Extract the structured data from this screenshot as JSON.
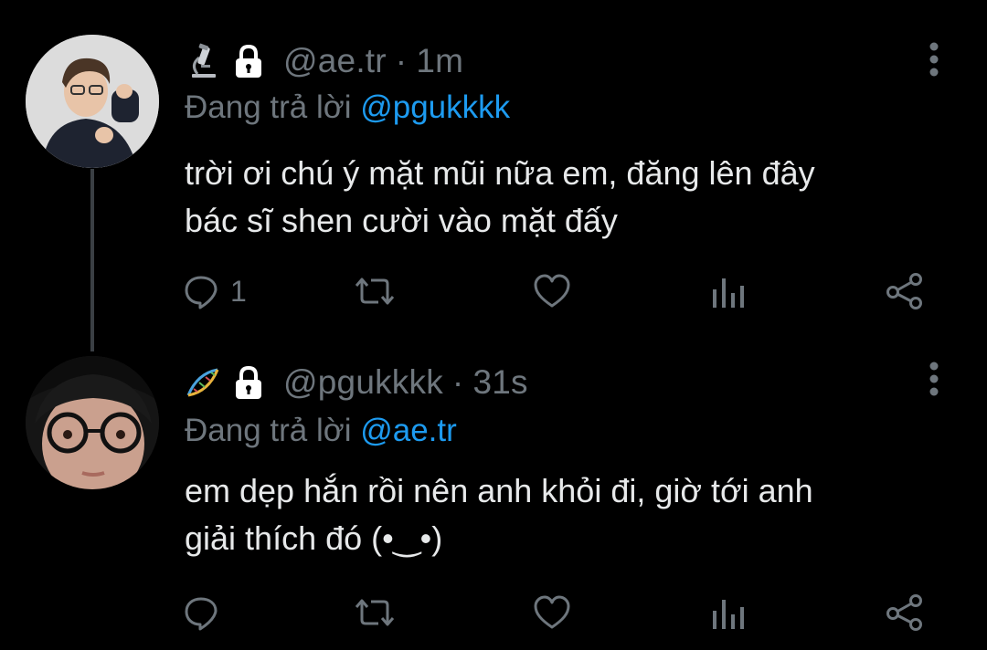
{
  "thread": [
    {
      "avatar_icon": "user-avatar-photo",
      "badge_icon": "microscope-icon",
      "lock_icon": "lock-icon",
      "handle": "@ae.tr",
      "separator": "·",
      "time": "1m",
      "reply_prefix": "Đang trả lời",
      "reply_to": "@pgukkkk",
      "text_lines": [
        "trời ơi chú ý mặt mũi nữa em, đăng lên đây",
        "bác sĩ shen cười vào mặt đấy"
      ],
      "reply_count": "1"
    },
    {
      "avatar_icon": "user-avatar-photo",
      "badge_icon": "dna-icon",
      "lock_icon": "lock-icon",
      "handle": "@pgukkkk",
      "separator": "·",
      "time": "31s",
      "reply_prefix": "Đang trả lời",
      "reply_to": "@ae.tr",
      "text_lines": [
        "em dẹp hắn rồi nên anh khỏi đi, giờ tới anh",
        "giải thích đó (•‿•)"
      ],
      "reply_count": ""
    }
  ],
  "colors": {
    "background": "#000000",
    "text_primary": "#e7e9ea",
    "text_secondary": "#6e767d",
    "accent": "#1d9bf0",
    "thread_line": "#3a3f44"
  }
}
